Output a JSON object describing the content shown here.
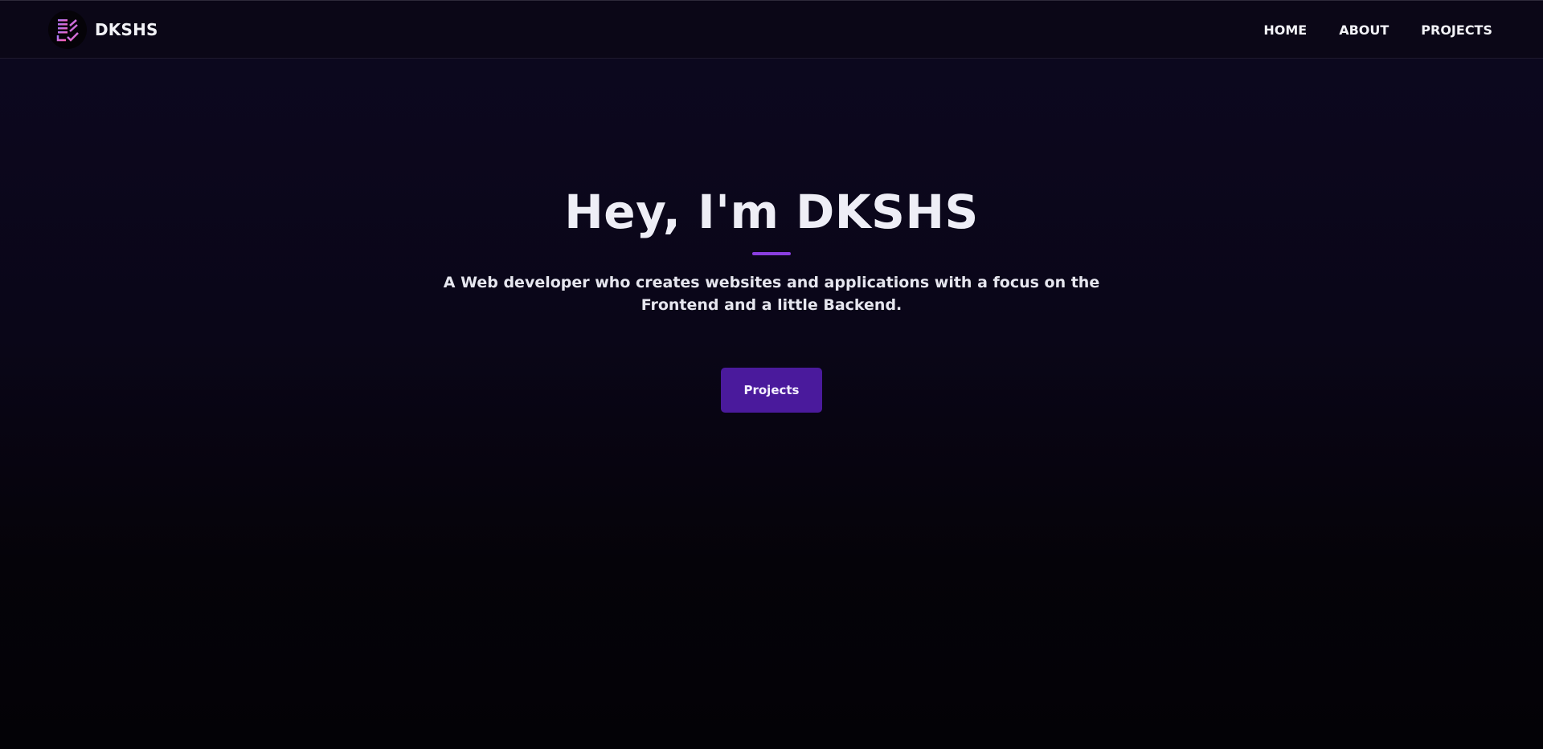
{
  "header": {
    "brand_name": "DKSHS",
    "nav": [
      {
        "label": "HOME"
      },
      {
        "label": "ABOUT"
      },
      {
        "label": "PROJECTS"
      }
    ]
  },
  "hero": {
    "title": "Hey, I'm DKSHS",
    "subtitle": "A Web developer who creates websites and applications with a focus on the Frontend and a little Backend.",
    "button_label": "Projects"
  },
  "colors": {
    "accent": "#8a3ee0",
    "button": "#4a1a9c",
    "background_top": "#0d0820",
    "background_bottom": "#030206",
    "text": "#eeeef6"
  },
  "icons": {
    "logo": "logo-icon"
  }
}
